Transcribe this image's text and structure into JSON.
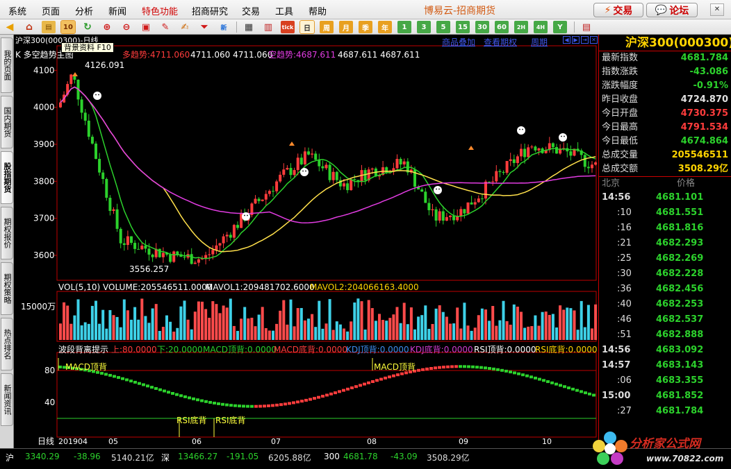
{
  "menu": {
    "items": [
      "系统",
      "页面",
      "分析",
      "新闻",
      "特色功能",
      "招商研究",
      "交易",
      "工具",
      "帮助"
    ],
    "app_title": "博易云-招商期货",
    "trade_button": "交易",
    "forum_button": "论坛"
  },
  "toolbar": {
    "period_buttons": [
      "日",
      "周",
      "月",
      "季",
      "年",
      "1",
      "3",
      "5",
      "15",
      "30",
      "60",
      "2H",
      "4H",
      "Y"
    ],
    "tick_label": "tick",
    "selected_period": "日"
  },
  "tooltip": {
    "text": "背景资料 F10"
  },
  "left_tabs": [
    "我的页面",
    "国内期货",
    "股指期货",
    "期权报价",
    "期权策略",
    "热点排名",
    "新闻资讯"
  ],
  "chart": {
    "symbol_label": "沪深300(000300)-日线",
    "indicator_name": "K  多空趋势主图",
    "bull_trend_label": "多趋势:4711.060",
    "bull_trend_extra": "4711.060 4711.060",
    "bear_trend_label": "空趋势:4687.611",
    "bear_trend_extra": "4687.611 4687.611",
    "top_links": [
      "商品叠加",
      "查看期权",
      "周期"
    ],
    "high_mark": "4126.091",
    "low_mark": "3556.257",
    "price_ticks": [
      "4100",
      "4000",
      "3900",
      "3800",
      "3700",
      "3600"
    ],
    "volume": {
      "title": "VOL(5,10) VOLUME:205546511.0000",
      "mavol1": "MAVOL1:209481702.6000",
      "mavol2": "MAVOL2:204066163.4000",
      "tick": "15000万"
    },
    "divergence": {
      "title": "波段背离提示",
      "upper": "上:80.0000",
      "lower": "下:20.0000",
      "macd_top": "MACD顶背:0.0000",
      "macd_bottom": "MACD底背:0.0000",
      "kdj_top": "KDJ顶背:0.0000",
      "kdj_bottom": "KDJ底背:0.0000",
      "rsi_top": "RSI顶背:0.0000",
      "rsi_bottom": "RSI底背:0.0000",
      "ticks": [
        "80",
        "40"
      ],
      "macd_top_signal": "MACD顶背",
      "rsi_bottom_signal": "RSI底背"
    },
    "date_axis": {
      "period_label": "日线",
      "labels": [
        "201904",
        "05",
        "06",
        "07",
        "08",
        "09",
        "10"
      ]
    }
  },
  "quote": {
    "title": "沪深300(000300)",
    "rows": [
      {
        "label": "最新指数",
        "value": "4681.784",
        "color": "#2cd12c"
      },
      {
        "label": "指数涨跌",
        "value": "-43.086",
        "color": "#2cd12c"
      },
      {
        "label": "涨跌幅度",
        "value": "-0.91%",
        "color": "#2cd12c"
      },
      {
        "label": "昨日收盘",
        "value": "4724.870",
        "color": "#e0e0e0"
      },
      {
        "label": "今日开盘",
        "value": "4730.375",
        "color": "#ff3c3c"
      },
      {
        "label": "今日最高",
        "value": "4791.534",
        "color": "#ff3c3c"
      },
      {
        "label": "今日最低",
        "value": "4674.864",
        "color": "#2cd12c"
      },
      {
        "label": "总成交量",
        "value": "205546511",
        "color": "#ffd400"
      },
      {
        "label": "总成交额",
        "value": "3508.29亿",
        "color": "#ffd400"
      }
    ],
    "tick_header": {
      "zone": "北京",
      "price": "价格"
    },
    "ticks": [
      {
        "time": "14:56",
        "price": "4681.101",
        "bold": true
      },
      {
        "time": ":10",
        "price": "4681.551",
        "bold": false
      },
      {
        "time": ":16",
        "price": "4681.816",
        "bold": false
      },
      {
        "time": ":21",
        "price": "4682.293",
        "bold": false
      },
      {
        "time": ":25",
        "price": "4682.269",
        "bold": false
      },
      {
        "time": ":30",
        "price": "4682.228",
        "bold": false
      },
      {
        "time": ":36",
        "price": "4682.456",
        "bold": false
      },
      {
        "time": ":40",
        "price": "4682.253",
        "bold": false
      },
      {
        "time": ":46",
        "price": "4682.537",
        "bold": false
      },
      {
        "time": ":51",
        "price": "4682.888",
        "bold": false
      },
      {
        "time": "14:56",
        "price": "4683.092",
        "bold": true
      },
      {
        "time": "14:57",
        "price": "4683.143",
        "bold": true
      },
      {
        "time": ":06",
        "price": "4683.355",
        "bold": false
      },
      {
        "time": "15:00",
        "price": "4681.852",
        "bold": true
      },
      {
        "time": ":27",
        "price": "4681.784",
        "bold": false
      }
    ]
  },
  "statusbar": {
    "sh_label": "沪",
    "sh_index": "3340.29",
    "sh_change": "-38.96",
    "sh_amount": "5140.21亿",
    "sz_label": "深",
    "sz_index": "13466.27",
    "sz_change": "-191.05",
    "sz_amount": "6205.88亿",
    "hs300_label": "300",
    "hs300_index": "4681.78",
    "hs300_change": "-43.09",
    "hs300_amount": "3508.29亿"
  },
  "logo": {
    "text": "分析家公式网",
    "url": "www.70822.com"
  },
  "colors": {
    "up": "#ff3c3c",
    "down": "#2cd12c",
    "accent": "#ffd400",
    "grid": "#c00000"
  }
}
